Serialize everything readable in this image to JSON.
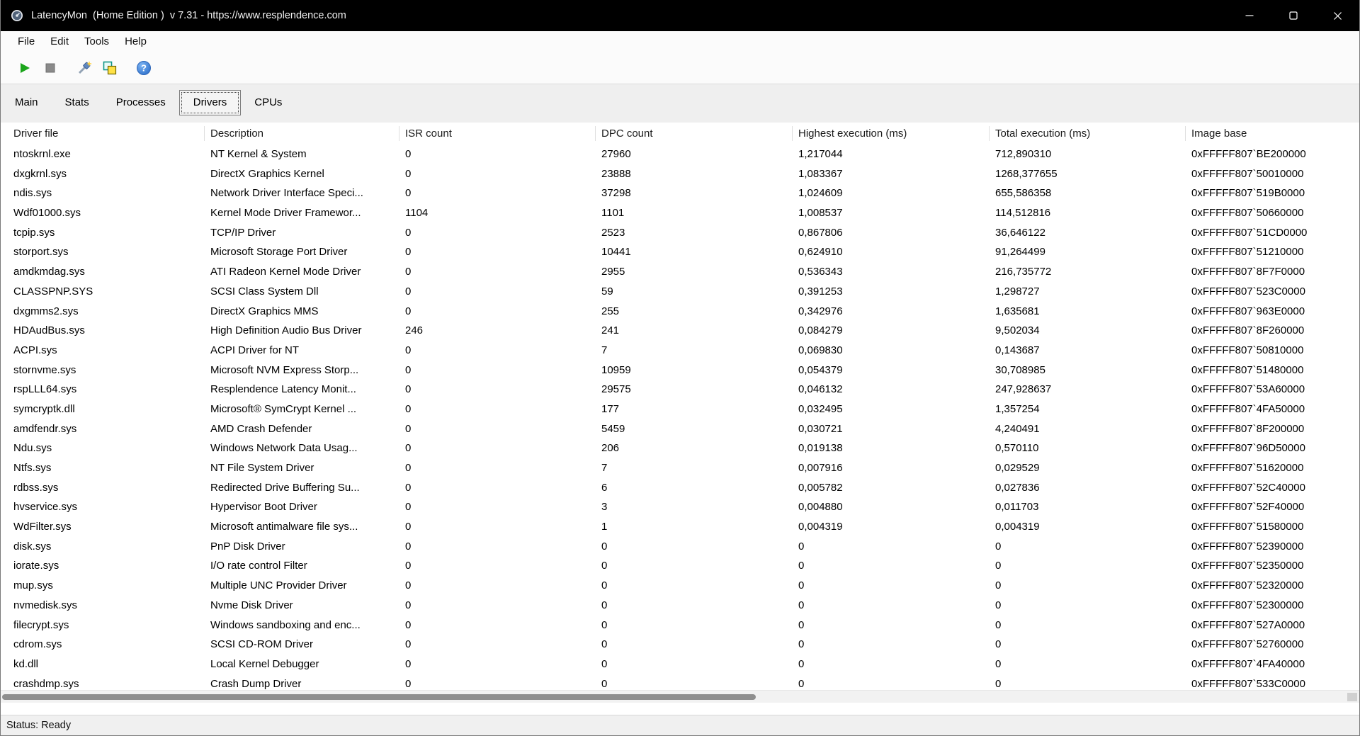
{
  "window": {
    "title": "LatencyMon  (Home Edition )  v 7.31 - https://www.resplendence.com"
  },
  "menu": {
    "items": [
      "File",
      "Edit",
      "Tools",
      "Help"
    ]
  },
  "toolbar": {
    "buttons": [
      {
        "name": "start-button",
        "icon": "play-icon"
      },
      {
        "name": "stop-button",
        "icon": "stop-icon"
      },
      {
        "name": "options-button",
        "icon": "tools-wand-icon"
      },
      {
        "name": "copy-report-button",
        "icon": "copy-icon"
      },
      {
        "name": "help-button",
        "icon": "help-icon"
      }
    ]
  },
  "tabs": {
    "items": [
      "Main",
      "Stats",
      "Processes",
      "Drivers",
      "CPUs"
    ],
    "active": "Drivers"
  },
  "table": {
    "columns": [
      "Driver file",
      "Description",
      "ISR count",
      "DPC count",
      "Highest execution (ms)",
      "Total execution (ms)",
      "Image base"
    ],
    "rows": [
      [
        "ntoskrnl.exe",
        "NT Kernel & System",
        "0",
        "27960",
        "1,217044",
        "712,890310",
        "0xFFFFF807`BE200000"
      ],
      [
        "dxgkrnl.sys",
        "DirectX Graphics Kernel",
        "0",
        "23888",
        "1,083367",
        "1268,377655",
        "0xFFFFF807`50010000"
      ],
      [
        "ndis.sys",
        "Network Driver Interface Speci...",
        "0",
        "37298",
        "1,024609",
        "655,586358",
        "0xFFFFF807`519B0000"
      ],
      [
        "Wdf01000.sys",
        "Kernel Mode Driver Framewor...",
        "1104",
        "1101",
        "1,008537",
        "114,512816",
        "0xFFFFF807`50660000"
      ],
      [
        "tcpip.sys",
        "TCP/IP Driver",
        "0",
        "2523",
        "0,867806",
        "36,646122",
        "0xFFFFF807`51CD0000"
      ],
      [
        "storport.sys",
        "Microsoft Storage Port Driver",
        "0",
        "10441",
        "0,624910",
        "91,264499",
        "0xFFFFF807`51210000"
      ],
      [
        "amdkmdag.sys",
        "ATI Radeon Kernel Mode Driver",
        "0",
        "2955",
        "0,536343",
        "216,735772",
        "0xFFFFF807`8F7F0000"
      ],
      [
        "CLASSPNP.SYS",
        "SCSI Class System Dll",
        "0",
        "59",
        "0,391253",
        "1,298727",
        "0xFFFFF807`523C0000"
      ],
      [
        "dxgmms2.sys",
        "DirectX Graphics MMS",
        "0",
        "255",
        "0,342976",
        "1,635681",
        "0xFFFFF807`963E0000"
      ],
      [
        "HDAudBus.sys",
        "High Definition Audio Bus Driver",
        "246",
        "241",
        "0,084279",
        "9,502034",
        "0xFFFFF807`8F260000"
      ],
      [
        "ACPI.sys",
        "ACPI Driver for NT",
        "0",
        "7",
        "0,069830",
        "0,143687",
        "0xFFFFF807`50810000"
      ],
      [
        "stornvme.sys",
        "Microsoft NVM Express Storp...",
        "0",
        "10959",
        "0,054379",
        "30,708985",
        "0xFFFFF807`51480000"
      ],
      [
        "rspLLL64.sys",
        "Resplendence Latency Monit...",
        "0",
        "29575",
        "0,046132",
        "247,928637",
        "0xFFFFF807`53A60000"
      ],
      [
        "symcryptk.dll",
        "Microsoft® SymCrypt Kernel ...",
        "0",
        "177",
        "0,032495",
        "1,357254",
        "0xFFFFF807`4FA50000"
      ],
      [
        "amdfendr.sys",
        "AMD Crash Defender",
        "0",
        "5459",
        "0,030721",
        "4,240491",
        "0xFFFFF807`8F200000"
      ],
      [
        "Ndu.sys",
        "Windows Network Data Usag...",
        "0",
        "206",
        "0,019138",
        "0,570110",
        "0xFFFFF807`96D50000"
      ],
      [
        "Ntfs.sys",
        "NT File System Driver",
        "0",
        "7",
        "0,007916",
        "0,029529",
        "0xFFFFF807`51620000"
      ],
      [
        "rdbss.sys",
        "Redirected Drive Buffering Su...",
        "0",
        "6",
        "0,005782",
        "0,027836",
        "0xFFFFF807`52C40000"
      ],
      [
        "hvservice.sys",
        "Hypervisor Boot Driver",
        "0",
        "3",
        "0,004880",
        "0,011703",
        "0xFFFFF807`52F40000"
      ],
      [
        "WdFilter.sys",
        "Microsoft antimalware file sys...",
        "0",
        "1",
        "0,004319",
        "0,004319",
        "0xFFFFF807`51580000"
      ],
      [
        "disk.sys",
        "PnP Disk Driver",
        "0",
        "0",
        "0",
        "0",
        "0xFFFFF807`52390000"
      ],
      [
        "iorate.sys",
        "I/O rate control Filter",
        "0",
        "0",
        "0",
        "0",
        "0xFFFFF807`52350000"
      ],
      [
        "mup.sys",
        "Multiple UNC Provider Driver",
        "0",
        "0",
        "0",
        "0",
        "0xFFFFF807`52320000"
      ],
      [
        "nvmedisk.sys",
        "Nvme Disk Driver",
        "0",
        "0",
        "0",
        "0",
        "0xFFFFF807`52300000"
      ],
      [
        "filecrypt.sys",
        "Windows sandboxing and enc...",
        "0",
        "0",
        "0",
        "0",
        "0xFFFFF807`527A0000"
      ],
      [
        "cdrom.sys",
        "SCSI CD-ROM Driver",
        "0",
        "0",
        "0",
        "0",
        "0xFFFFF807`52760000"
      ],
      [
        "kd.dll",
        "Local Kernel Debugger",
        "0",
        "0",
        "0",
        "0",
        "0xFFFFF807`4FA40000"
      ],
      [
        "crashdmp.sys",
        "Crash Dump Driver",
        "0",
        "0",
        "0",
        "0",
        "0xFFFFF807`533C0000"
      ]
    ]
  },
  "scrollbar": {
    "horizontal_thumb_percent": 55.5
  },
  "statusbar": {
    "text": "Status: Ready"
  },
  "colors": {
    "titlebar": "#000000",
    "play_green": "#1ba51b",
    "stop_gray": "#8a8a8a",
    "help_blue": "#1f63c4",
    "copy_yellow": "#ffe145",
    "copy_teal": "#0e9486",
    "tab_band": "#efefef",
    "scrollbar_thumb": "#8f8f8f"
  }
}
